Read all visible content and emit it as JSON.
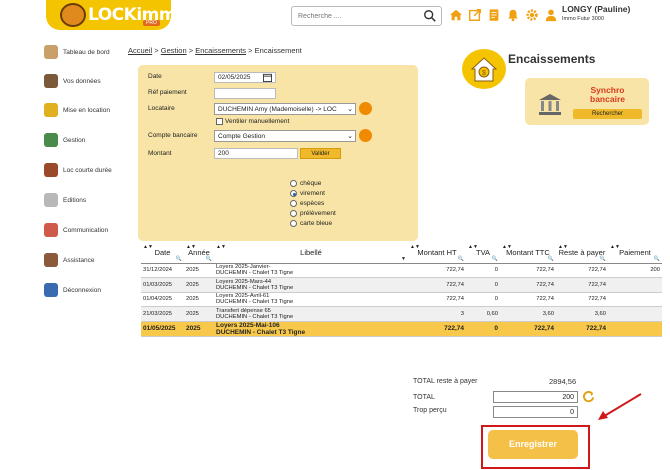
{
  "header": {
    "logo_text": "LOCKimmo.io",
    "logo_badge": "PRO",
    "search_placeholder": "Recherche ....",
    "user_name": "LONGY (Pauline)",
    "user_company": "Immo Futur 3000"
  },
  "sidebar": {
    "items": [
      {
        "label": "Tableau de bord",
        "icon": "dashboard-icon"
      },
      {
        "label": "Vos données",
        "icon": "user-icon"
      },
      {
        "label": "Mise en location",
        "icon": "keys-icon"
      },
      {
        "label": "Gestion",
        "icon": "management-icon"
      },
      {
        "label": "Loc courte durée",
        "icon": "suitcase-icon"
      },
      {
        "label": "Editions",
        "icon": "print-icon"
      },
      {
        "label": "Communication",
        "icon": "chat-icon"
      },
      {
        "label": "Assistance",
        "icon": "support-icon"
      },
      {
        "label": "Déconnexion",
        "icon": "logout-icon"
      }
    ]
  },
  "breadcrumb": {
    "home": "Accueil",
    "gestion": "Gestion",
    "encaissements": "Encaissements",
    "current": "Encaissement",
    "sep": ">"
  },
  "page_title": "Encaissements",
  "synchro": {
    "title_line1": "Synchro",
    "title_line2": "bancaire",
    "button": "Rechercher"
  },
  "form": {
    "date_label": "Date",
    "date_value": "02/05/2025",
    "ref_label": "Réf paiement",
    "ref_value": "",
    "locataire_label": "Locataire",
    "locataire_value": "DUCHEMIN Amy (Mademoiselle) -> LOC",
    "ventiler_label": "Ventiler manuellement",
    "compte_label": "Compte bancaire",
    "compte_value": "Compte Gestion",
    "montant_label": "Montant",
    "montant_value": "200",
    "valider": "Valider",
    "payment_modes": [
      "chèque",
      "virement",
      "espèces",
      "prélèvement",
      "carte bleue"
    ],
    "selected_mode": "virement"
  },
  "table": {
    "headers": [
      "Date",
      "Année",
      "Libellé",
      "Montant HT",
      "TVA",
      "Montant TTC",
      "Reste à payer",
      "Paiement"
    ],
    "rows": [
      {
        "date": "31/12/2024",
        "annee": "2025",
        "lib1": "Loyers 2025-Janvier-",
        "lib2": "DUCHEMIN - Chalet T3 Tigne",
        "ht": "722,74",
        "tva": "0",
        "ttc": "722,74",
        "reste": "722,74",
        "paiement": "200"
      },
      {
        "date": "01/03/2025",
        "annee": "2025",
        "lib1": "Loyers 2025-Mars-44",
        "lib2": "DUCHEMIN - Chalet T3 Tigne",
        "ht": "722,74",
        "tva": "0",
        "ttc": "722,74",
        "reste": "722,74",
        "paiement": ""
      },
      {
        "date": "01/04/2025",
        "annee": "2025",
        "lib1": "Loyers 2025-Avril-61",
        "lib2": "DUCHEMIN - Chalet T3 Tigne",
        "ht": "722,74",
        "tva": "0",
        "ttc": "722,74",
        "reste": "722,74",
        "paiement": ""
      },
      {
        "date": "21/03/2025",
        "annee": "2025",
        "lib1": "Transfert dépense 65",
        "lib2": "DUCHEMIN - Chalet T3 Tigne",
        "ht": "3",
        "tva": "0,60",
        "ttc": "3,60",
        "reste": "3,60",
        "paiement": ""
      },
      {
        "date": "01/05/2025",
        "annee": "2025",
        "lib1": "Loyers 2025-Mai-106",
        "lib2": "DUCHEMIN - Chalet T3 Tigne",
        "ht": "722,74",
        "tva": "0",
        "ttc": "722,74",
        "reste": "722,74",
        "paiement": ""
      }
    ]
  },
  "totals": {
    "reste_label": "TOTAL reste à payer",
    "reste_value": "2894,56",
    "total_label": "TOTAL",
    "total_value": "200",
    "trop_label": "Trop perçu",
    "trop_value": "0"
  },
  "enregistrer": "Enregistrer",
  "colors": {
    "accent": "#f5c400",
    "panel": "#f8e4a6",
    "highlight": "#d01818"
  }
}
